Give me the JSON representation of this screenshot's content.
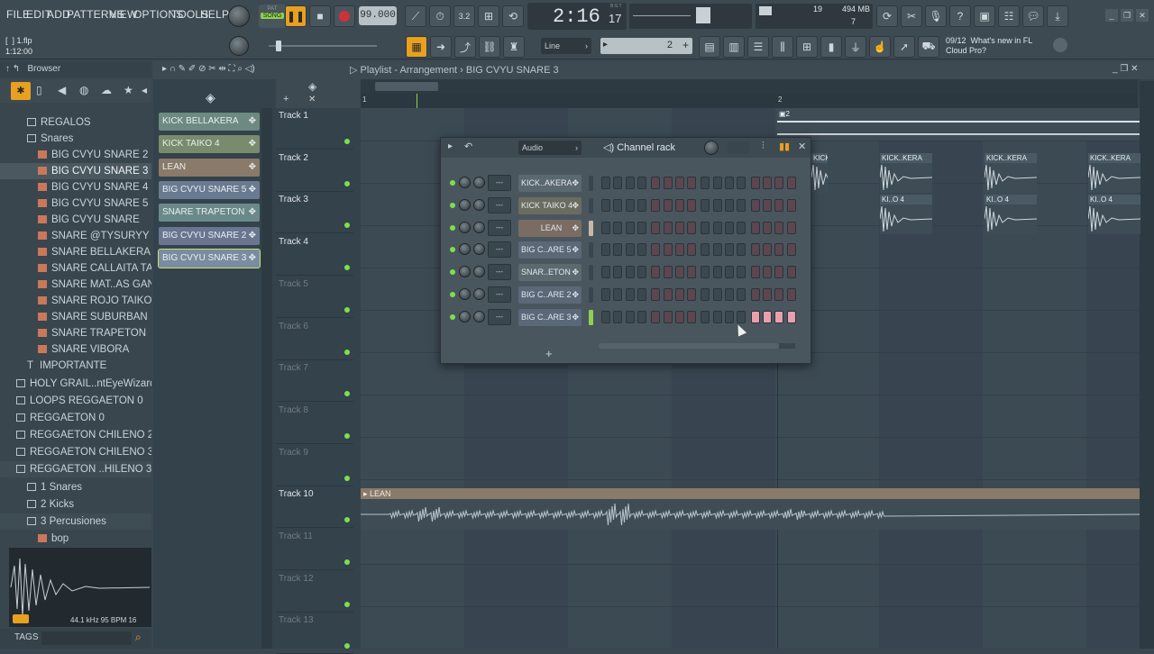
{
  "menu": [
    "FILE",
    "EDIT",
    "ADD",
    "PATTERNS",
    "VIEW",
    "OPTIONS",
    "TOOLS",
    "HELP"
  ],
  "transport": {
    "mode_pat": "PAT",
    "mode_song": "SONG",
    "tempo": "99.000",
    "time": "2:16",
    "time_small": "17",
    "time_label": "B:S:T"
  },
  "cpu": {
    "value": "19",
    "memory": "494 MB",
    "voices": "7"
  },
  "project": {
    "file": "1.flp",
    "position": "1:12:00"
  },
  "snap": {
    "mode": "Line",
    "step": "2"
  },
  "news": {
    "date": "09/12",
    "text": "What's new in FL Cloud Pro?"
  },
  "browser": {
    "title": "Browser",
    "items": [
      {
        "label": "REGALOS",
        "indent": 2,
        "kind": "folder"
      },
      {
        "label": "Snares",
        "indent": 2,
        "kind": "folder"
      },
      {
        "label": "BIG CVYU SNARE 2",
        "indent": 3,
        "kind": "audio"
      },
      {
        "label": "BIG CVYU SNARE 3",
        "indent": 3,
        "kind": "audio",
        "selected": true
      },
      {
        "label": "BIG CVYU SNARE 4",
        "indent": 3,
        "kind": "audio"
      },
      {
        "label": "BIG CVYU SNARE 5",
        "indent": 3,
        "kind": "audio"
      },
      {
        "label": "BIG CVYU SNARE",
        "indent": 3,
        "kind": "audio"
      },
      {
        "label": "SNARE @TYSURYY",
        "indent": 3,
        "kind": "audio"
      },
      {
        "label": "SNARE BELLAKERA",
        "indent": 3,
        "kind": "audio"
      },
      {
        "label": "SNARE CALLAITA TAINY",
        "indent": 3,
        "kind": "audio"
      },
      {
        "label": "SNARE MAT..AS GANAS",
        "indent": 3,
        "kind": "audio"
      },
      {
        "label": "SNARE ROJO TAIKO",
        "indent": 3,
        "kind": "audio"
      },
      {
        "label": "SNARE SUBURBAN",
        "indent": 3,
        "kind": "audio"
      },
      {
        "label": "SNARE TRAPETON",
        "indent": 3,
        "kind": "audio"
      },
      {
        "label": "SNARE VIBORA",
        "indent": 3,
        "kind": "audio"
      },
      {
        "label": "IMPORTANTE",
        "indent": 2,
        "kind": "text"
      },
      {
        "label": "HOLY GRAIL..ntEyeWizard",
        "indent": 1,
        "kind": "folder"
      },
      {
        "label": "LOOPS REGGAETON 0",
        "indent": 1,
        "kind": "folder"
      },
      {
        "label": "REGGAETON 0",
        "indent": 1,
        "kind": "folder"
      },
      {
        "label": "REGGAETON CHILENO 2",
        "indent": 1,
        "kind": "folder"
      },
      {
        "label": "REGGAETON CHILENO 3",
        "indent": 1,
        "kind": "folder"
      },
      {
        "label": "REGGAETON ..HILENO 3.1",
        "indent": 1,
        "kind": "folder",
        "open": true
      },
      {
        "label": "1 Snares",
        "indent": 2,
        "kind": "folder"
      },
      {
        "label": "2 Kicks",
        "indent": 2,
        "kind": "folder"
      },
      {
        "label": "3 Percusiones",
        "indent": 2,
        "kind": "folder",
        "open": true
      },
      {
        "label": "bop",
        "indent": 3,
        "kind": "audio"
      }
    ],
    "sample_info": "44.1 kHz 95 BPM 16",
    "tags_label": "TAGS"
  },
  "playlist": {
    "title": "Playlist - Arrangement",
    "pattern": "BIG CVYU SNARE 3",
    "patterns": [
      {
        "label": "KICK BELLAKERA",
        "color": "#6c8a80"
      },
      {
        "label": "KICK TAIKO 4",
        "color": "#7a8a6c"
      },
      {
        "label": "LEAN",
        "color": "#8a7a6a"
      },
      {
        "label": "BIG CVYU SNARE 5",
        "color": "#6a7a90"
      },
      {
        "label": "SNARE TRAPETON",
        "color": "#6a8a8a"
      },
      {
        "label": "BIG CVYU SNARE 2",
        "color": "#6a7690"
      },
      {
        "label": "BIG CVYU SNARE 3",
        "color": "#7a8ca0"
      }
    ],
    "tracks": [
      "Track 1",
      "Track 2",
      "Track 3",
      "Track 4",
      "Track 5",
      "Track 6",
      "Track 7",
      "Track 8",
      "Track 9",
      "Track 10",
      "Track 11",
      "Track 12",
      "Track 13"
    ],
    "ruler_marks": [
      "1",
      "2"
    ],
    "clips": [
      {
        "label": "KICK..KERA",
        "track": 2
      },
      {
        "label": "KI..O 4",
        "track": 3
      },
      {
        "label": "LEAN",
        "track": 10
      }
    ]
  },
  "channel_rack": {
    "title": "Channel rack",
    "group": "Audio",
    "channels": [
      {
        "name": "KICK..AKERA",
        "color": "#5a6870"
      },
      {
        "name": "KICK TAIKO 4",
        "color": "#6a6c60"
      },
      {
        "name": "LEAN",
        "color": "#7a6c62"
      },
      {
        "name": "BIG C..ARE 5",
        "color": "#5a6878"
      },
      {
        "name": "SNAR..ETON",
        "color": "#5a6a6e"
      },
      {
        "name": "BIG C..ARE 2",
        "color": "#5a6878"
      },
      {
        "name": "BIG C..ARE 3",
        "color": "#5a6878",
        "selected": true
      }
    ],
    "add_label": "+"
  },
  "colors": {
    "accent": "#7ee04a",
    "active_orange": "#e8a020",
    "record": "#d0303a",
    "step_on": "#e9a0ac"
  }
}
